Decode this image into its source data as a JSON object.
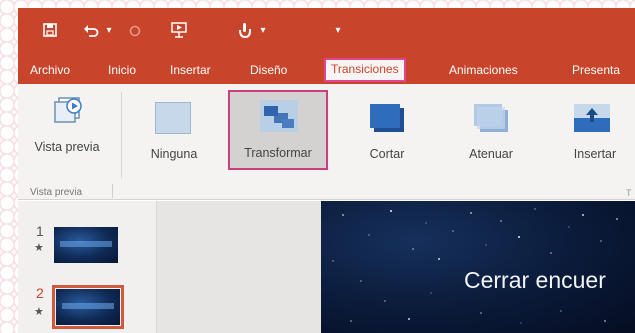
{
  "quick_access": {
    "save_icon": "save-icon",
    "undo_icon": "undo-icon",
    "undo_dropdown": "▾",
    "redo_icon": "redo-icon",
    "present_icon": "present-from-start-icon",
    "touch_icon": "touch-mode-icon",
    "touch_dropdown": "▾",
    "customize_icon": "customize-qat-icon",
    "customize_glyph": "▾"
  },
  "tabs": [
    {
      "label": "Archivo"
    },
    {
      "label": "Inicio"
    },
    {
      "label": "Insertar"
    },
    {
      "label": "Diseño"
    },
    {
      "label": "Transiciones",
      "active": true
    },
    {
      "label": "Animaciones"
    },
    {
      "label": "Presenta"
    }
  ],
  "ribbon": {
    "preview_label": "Vista previa",
    "group_label": "Vista previa",
    "corner_label": "T",
    "transitions": [
      {
        "label": "Ninguna",
        "icon": "none-transition-icon"
      },
      {
        "label": "Transformar",
        "icon": "morph-transition-icon",
        "selected": true
      },
      {
        "label": "Cortar",
        "icon": "cut-transition-icon"
      },
      {
        "label": "Atenuar",
        "icon": "fade-transition-icon"
      },
      {
        "label": "Insertar",
        "icon": "push-transition-icon"
      }
    ]
  },
  "slides": [
    {
      "number": "1",
      "star": "★",
      "selected": false
    },
    {
      "number": "2",
      "star": "★",
      "selected": true
    }
  ],
  "main_slide": {
    "title": "Cerrar encuer"
  },
  "colors": {
    "accent": "#c8442a",
    "tab_highlight": "#e0458d",
    "selected_tile_border": "#c9407a"
  }
}
